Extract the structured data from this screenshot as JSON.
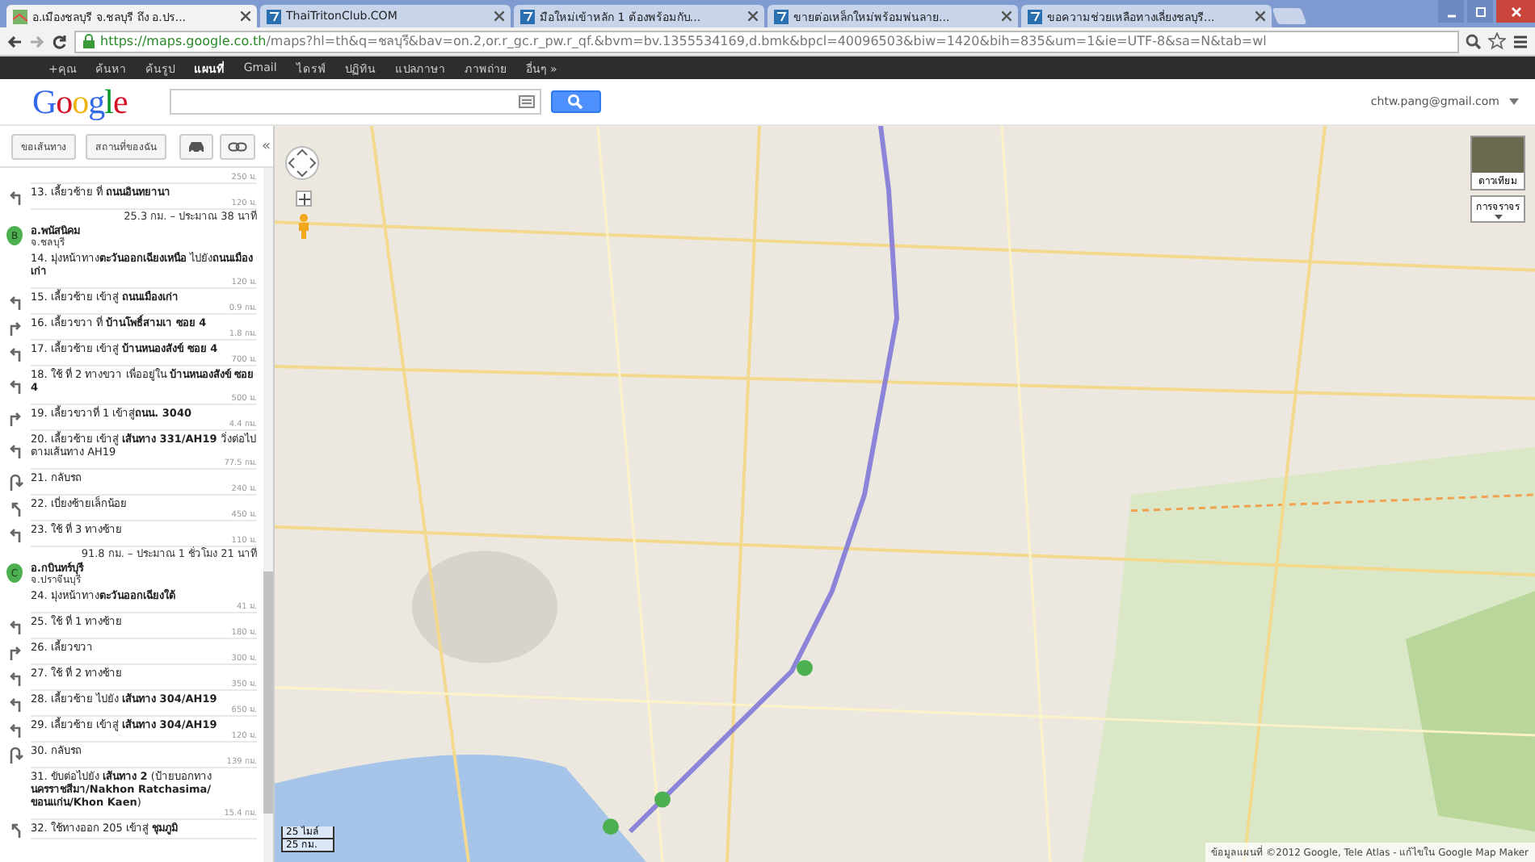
{
  "browser": {
    "tabs": [
      {
        "title": "อ.เมืองชลบุรี จ.ชลบุรี ถึง อ.ปร...",
        "selected": true
      },
      {
        "title": "ThaiTritonClub.COM",
        "selected": false
      },
      {
        "title": "มือใหม่เข้าหลัก 1 ต้องพร้อมกับ...",
        "selected": false
      },
      {
        "title": "ขายต่อเหล็กใหม่พร้อมพ่นลาย...",
        "selected": false
      },
      {
        "title": "ขอความช่วยเหลือทางเลี่ยงชลบุรี...",
        "selected": false
      }
    ],
    "url_host": "https://maps.google.co.th",
    "url_path": "/maps?hl=th&q=ชลบุรี&bav=on.2,or.r_gc.r_pw.r_qf.&bvm=bv.1355534169,d.bmk&bpcl=40096503&biw=1420&bih=835&um=1&ie=UTF-8&sa=N&tab=wl"
  },
  "google_bar": [
    {
      "label": "+คุณ",
      "selected": false
    },
    {
      "label": "ค้นหา",
      "selected": false
    },
    {
      "label": "ค้นรูป",
      "selected": false
    },
    {
      "label": "แผนที่",
      "selected": true
    },
    {
      "label": "Gmail",
      "selected": false
    },
    {
      "label": "ไดรฟ์",
      "selected": false
    },
    {
      "label": "ปฏิทิน",
      "selected": false
    },
    {
      "label": "แปลภาษา",
      "selected": false
    },
    {
      "label": "ภาพถ่าย",
      "selected": false
    },
    {
      "label": "อื่นๆ »",
      "selected": false
    }
  ],
  "header": {
    "logo": "Google",
    "account": "chtw.pang@gmail.com"
  },
  "sidebar": {
    "buttons": [
      "ขอเส้นทาง",
      "สถานที่ของฉัน"
    ],
    "collapse": "«",
    "steps": [
      {
        "kind": "distance",
        "distance": "250 ม."
      },
      {
        "kind": "turn-left",
        "number": "13.",
        "text": "เลี้ยวซ้าย ที่ **ถนนอินทยานา**",
        "distance": "120 ม."
      },
      {
        "kind": "summary",
        "text": "25.3 กม. – ประมาณ 38 นาที"
      },
      {
        "kind": "waypoint",
        "marker": "B",
        "name": "อ.พนัสนิคม",
        "province": "จ.ชลบุรี"
      },
      {
        "kind": "depart",
        "number": "14.",
        "text": "มุ่งหน้าทาง**ตะวันออกเฉียงเหนือ** ไปยัง**ถนนเมืองเก่า**",
        "distance": "120 ม."
      },
      {
        "kind": "turn-left",
        "number": "15.",
        "text": "เลี้ยวซ้าย เข้าสู่ **ถนนเมืองเก่า**",
        "distance": "0.9 กม."
      },
      {
        "kind": "turn-right",
        "number": "16.",
        "text": "เลี้ยวขวา ที่ **บ้านโพธิ์สามเา ซอย 4**",
        "distance": "1.8 กม."
      },
      {
        "kind": "turn-left",
        "number": "17.",
        "text": "เลี้ยวซ้าย เข้าสู่ **บ้านหนองสังข์ ซอย 4**",
        "distance": "700 ม."
      },
      {
        "kind": "turn-left",
        "number": "18.",
        "text": "ใช้ ที่ 2 ทางขวา เพื่ออยู่ใน **บ้านหนองสังข์ ซอย 4**",
        "distance": "500 ม."
      },
      {
        "kind": "turn-right",
        "number": "19.",
        "text": "เลี้ยวขวาที่ 1 เข้าสู่**ถนน. 3040**",
        "distance": "4.4 กม."
      },
      {
        "kind": "turn-left",
        "number": "20.",
        "text": "เลี้ยวซ้าย เข้าสู่ **เส้นทาง 331/AH19** วิ่งต่อไปตามเส้นทาง AH19",
        "distance": "77.5 กม."
      },
      {
        "kind": "u-turn",
        "number": "21.",
        "text": "กลับรถ",
        "distance": "240 ม."
      },
      {
        "kind": "slight-left",
        "number": "22.",
        "text": "เบี่ยงซ้ายเล็กน้อย",
        "distance": "450 ม."
      },
      {
        "kind": "turn-left",
        "number": "23.",
        "text": "ใช้ ที่ 3 ทางซ้าย",
        "distance": "110 ม."
      },
      {
        "kind": "summary",
        "text": "91.8 กม. – ประมาณ 1 ชั่วโมง 21 นาที"
      },
      {
        "kind": "waypoint",
        "marker": "C",
        "name": "อ.กบินทร์บุรี",
        "province": "จ.ปราจีนบุรี"
      },
      {
        "kind": "depart",
        "number": "24.",
        "text": "มุ่งหน้าทาง**ตะวันออกเฉียงใต้**",
        "distance": "41 ม."
      },
      {
        "kind": "turn-left",
        "number": "25.",
        "text": "ใช้ ที่ 1 ทางซ้าย",
        "distance": "180 ม."
      },
      {
        "kind": "turn-right",
        "number": "26.",
        "text": "เลี้ยวขวา",
        "distance": "300 ม."
      },
      {
        "kind": "turn-left",
        "number": "27.",
        "text": "ใช้ ที่ 2 ทางซ้าย",
        "distance": "350 ม."
      },
      {
        "kind": "turn-left",
        "number": "28.",
        "text": "เลี้ยวซ้าย ไปยัง **เส้นทาง 304/AH19**",
        "distance": "650 ม."
      },
      {
        "kind": "turn-left",
        "number": "29.",
        "text": "เลี้ยวซ้าย เข้าสู่ **เส้นทาง 304/AH19**",
        "distance": "120 ม."
      },
      {
        "kind": "u-turn",
        "number": "30.",
        "text": "กลับรถ",
        "distance": "139 กม."
      },
      {
        "kind": "depart",
        "number": "31.",
        "text": "ขับต่อไปยัง **เส้นทาง 2** (ป้ายบอกทาง **นครราชสีมา/Nakhon Ratchasima/ ขอนแก่น/Khon Kaen**)",
        "distance": "15.4 กม."
      },
      {
        "kind": "slight-left",
        "number": "32.",
        "text": "ใช้ทางออก 205 เข้าสู่ **ชุมภูมิ**"
      }
    ]
  },
  "map": {
    "kind": "picture",
    "map_types": [
      "ดาวเทียม",
      "การจราจร"
    ],
    "scale": [
      "25 ไมล์",
      "25 กม."
    ],
    "attribution": "ข้อมูลแผนที่ ©2012 Google, Tele Atlas - แก้ไขใน Google Map Maker"
  }
}
